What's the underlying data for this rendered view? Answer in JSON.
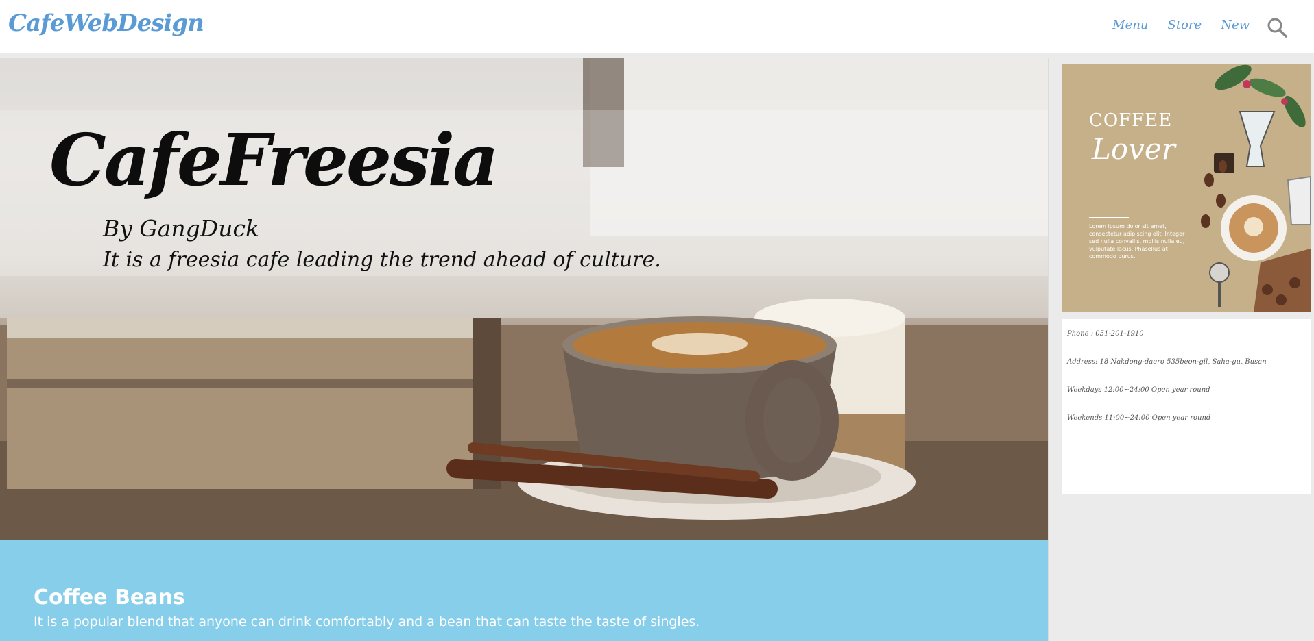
{
  "header": {
    "logo": "CafeWebDesign",
    "nav": [
      {
        "label": "Menu"
      },
      {
        "label": "Store"
      },
      {
        "label": "New"
      }
    ]
  },
  "hero": {
    "title": "CafeFreesia",
    "byline": "By GangDuck",
    "tagline": "It is a freesia cafe leading the trend ahead of culture."
  },
  "beans": {
    "title": "Coffee Beans",
    "description": "It is a popular blend that anyone can drink comfortably and a bean that can taste the taste of singles."
  },
  "sidebar": {
    "poster": {
      "heading": "COFFEE",
      "script": "Lover",
      "body": "Lorem ipsum dolor sit amet, consectetur adipiscing elit. Integer sed nulla convallis, mollis nulla eu, vulputate lacus. Phasellus at commodo purus."
    },
    "info": {
      "phone": "Phone : 051-201-1910",
      "address": "Address: 18 Nakdong-daero 535beon-gil, Saha-gu, Busan",
      "weekdays": "Weekdays 12:00~24:00 Open year round",
      "weekends": "Weekends 11:00~24:00 Open year round"
    }
  },
  "colors": {
    "accent": "#5b9bd5",
    "band": "#87ceeb",
    "poster": "#c6b08a"
  }
}
